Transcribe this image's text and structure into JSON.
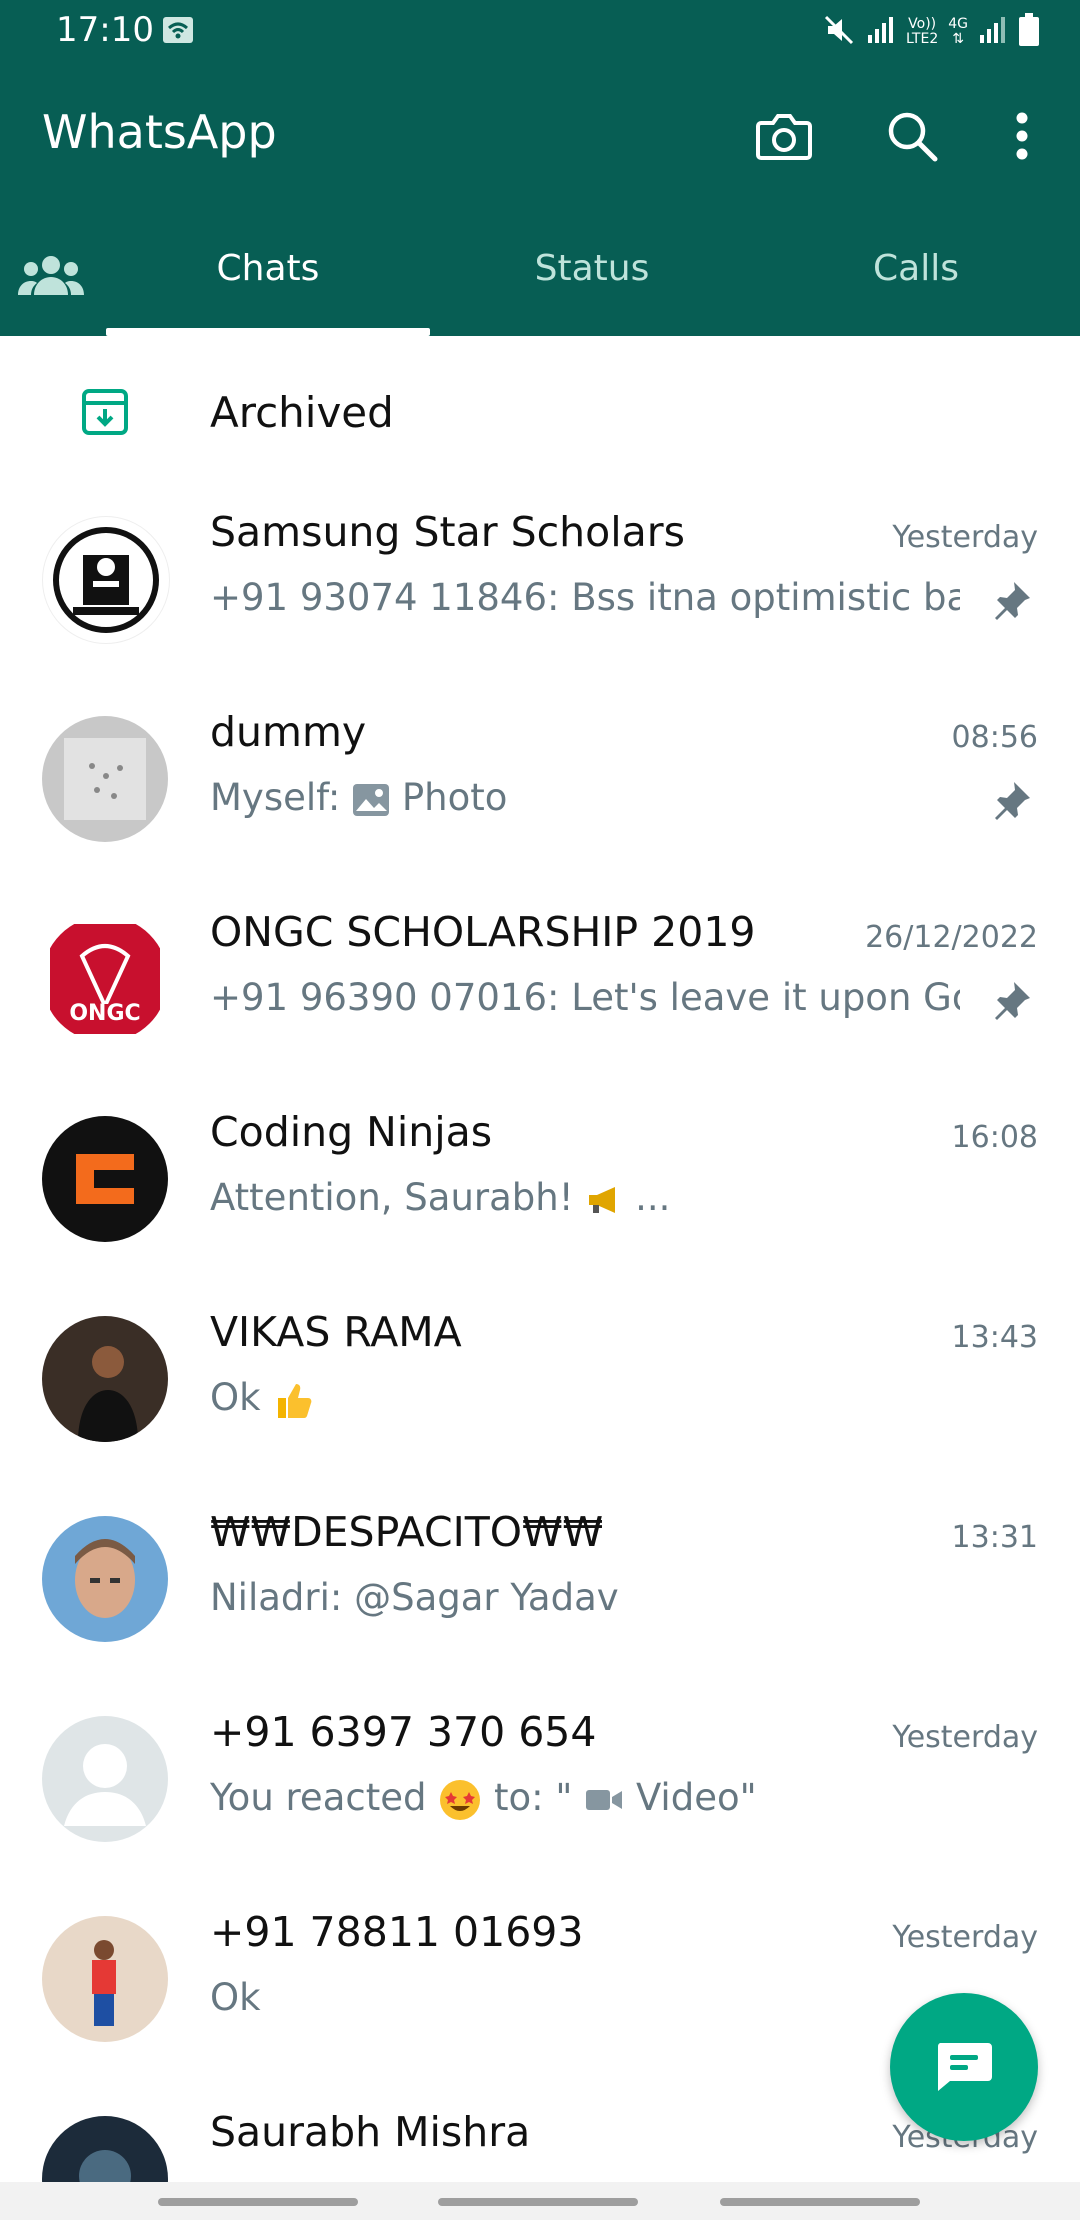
{
  "status_bar": {
    "time": "17:10",
    "volte_top": "Vo))",
    "volte_bottom": "LTE2",
    "net": "4G"
  },
  "app_bar": {
    "title": "WhatsApp"
  },
  "tabs": [
    {
      "label": "Chats",
      "active": true
    },
    {
      "label": "Status",
      "active": false
    },
    {
      "label": "Calls",
      "active": false
    }
  ],
  "archived": {
    "label": "Archived"
  },
  "chats": [
    {
      "name": "Samsung Star Scholars",
      "time": "Yesterday",
      "preview": "+91 93074 11846: Bss itna optimistic ba...",
      "pinned": true
    },
    {
      "name": "dummy",
      "time": "08:56",
      "preview_sender": "Myself:",
      "preview_text": "Photo",
      "pinned": true
    },
    {
      "name": "ONGC SCHOLARSHIP 2019",
      "time": "26/12/2022",
      "preview": "+91 96390 07016: Let's leave it upon Go...",
      "pinned": true
    },
    {
      "name": "Coding Ninjas",
      "time": "16:08",
      "preview_text": "Attention, Saurabh!",
      "preview_suffix": "...",
      "pinned": false
    },
    {
      "name": "VIKAS RAMA",
      "time": "13:43",
      "preview_text": "Ok",
      "pinned": false
    },
    {
      "name": "₩₩DESPACITO₩₩",
      "time": "13:31",
      "preview": "Niladri: @Sagar Yadav",
      "pinned": false
    },
    {
      "name": "+91 6397 370 654",
      "time": "Yesterday",
      "preview_prefix": "You reacted",
      "preview_mid": "to: \"",
      "preview_video": "Video\"",
      "pinned": false
    },
    {
      "name": "+91 78811 01693",
      "time": "Yesterday",
      "preview": "Ok",
      "pinned": false
    },
    {
      "name": "Saurabh Mishra",
      "time": "Yesterday",
      "preview": "",
      "pinned": false
    }
  ],
  "colors": {
    "header": "#075e54",
    "accent": "#00a884",
    "secondary_text": "#667781"
  }
}
